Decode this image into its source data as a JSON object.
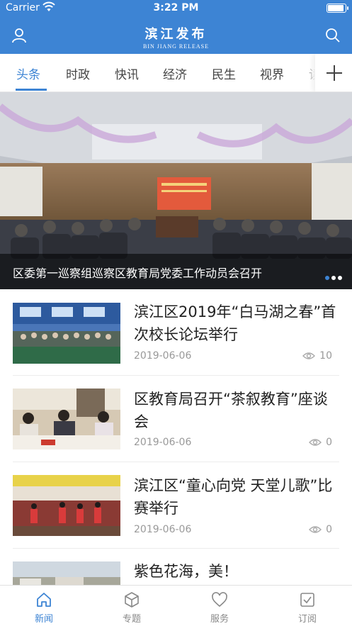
{
  "status_bar": {
    "carrier": "Carrier",
    "time": "3:22 PM"
  },
  "header": {
    "title_cn": "滨江发布",
    "title_en": "BIN JIANG RELEASE",
    "user_icon": "user-icon",
    "search_icon": "search-icon"
  },
  "tabs": [
    {
      "label": "头条",
      "active": true
    },
    {
      "label": "时政"
    },
    {
      "label": "快讯"
    },
    {
      "label": "经济"
    },
    {
      "label": "民生"
    },
    {
      "label": "视界"
    },
    {
      "label": "读"
    }
  ],
  "banner": {
    "caption": "区委第一巡察组巡察区教育局党委工作动员会召开",
    "slide_count": 3,
    "active_slide": 1
  },
  "news": [
    {
      "title": "滨江区2019年“白马湖之春”首次校长论坛举行",
      "date": "2019-06-06",
      "views": "10"
    },
    {
      "title": "区教育局召开“茶叙教育”座谈会",
      "date": "2019-06-06",
      "views": "0"
    },
    {
      "title": "滨江区“童心向党 天堂儿歌”比赛举行",
      "date": "2019-06-06",
      "views": "0"
    },
    {
      "title": "紫色花海，美！",
      "date": "",
      "views": ""
    }
  ],
  "bottom_nav": [
    {
      "label": "新闻",
      "icon": "home-icon",
      "active": true
    },
    {
      "label": "专题",
      "icon": "cube-icon"
    },
    {
      "label": "服务",
      "icon": "heart-icon"
    },
    {
      "label": "订阅",
      "icon": "checkbox-icon"
    }
  ],
  "colors": {
    "brand": "#3d84d4",
    "text": "#222222",
    "muted": "#999999"
  }
}
